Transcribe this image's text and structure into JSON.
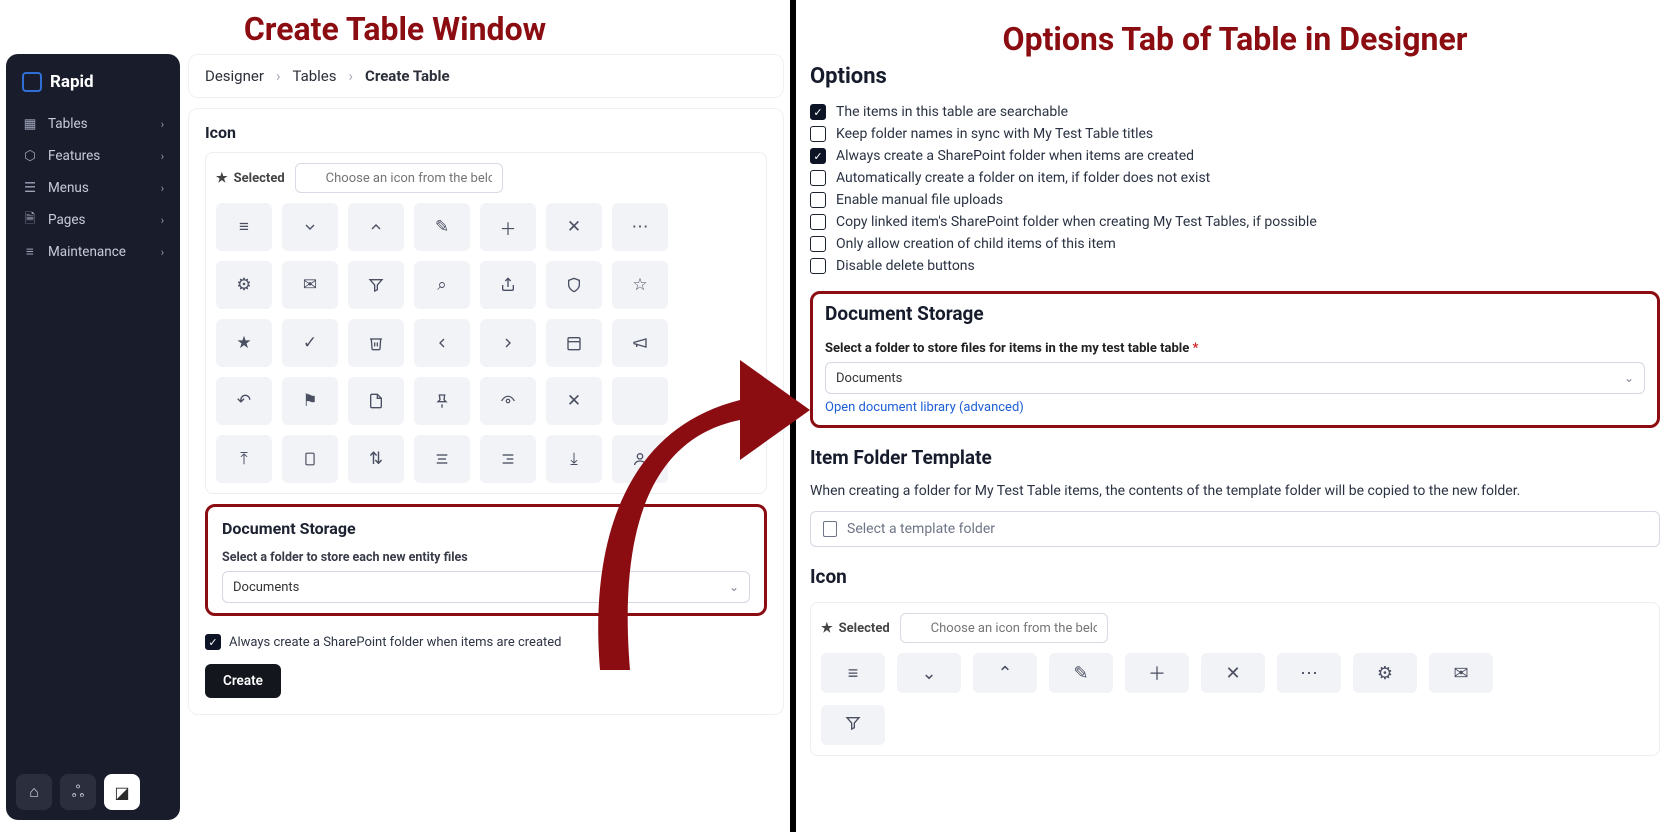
{
  "left_title": "Create Table Window",
  "right_title": "Options Tab of Table in Designer",
  "brand": "Rapid",
  "nav": {
    "items": [
      "Tables",
      "Features",
      "Menus",
      "Pages",
      "Maintenance"
    ]
  },
  "breadcrumb": {
    "a": "Designer",
    "b": "Tables",
    "c": "Create Table"
  },
  "icon_card": {
    "title": "Icon",
    "selected_label": "Selected",
    "search_placeholder": "Choose an icon from the below list..."
  },
  "doc_store_left": {
    "title": "Document Storage",
    "label": "Select a folder to store each new entity files",
    "value": "Documents",
    "check": "Always create a SharePoint folder when items are created"
  },
  "create_btn": "Create",
  "options": {
    "title": "Options",
    "rows": [
      {
        "checked": true,
        "label": "The items in this table are searchable"
      },
      {
        "checked": false,
        "label": "Keep folder names in sync with My Test Table titles"
      },
      {
        "checked": true,
        "label": "Always create a SharePoint folder when items are created"
      },
      {
        "checked": false,
        "label": "Automatically create a folder on item, if folder does not exist"
      },
      {
        "checked": false,
        "label": "Enable manual file uploads"
      },
      {
        "checked": false,
        "label": "Copy linked item's SharePoint folder when creating My Test Tables, if possible"
      },
      {
        "checked": false,
        "label": "Only allow creation of child items of this item"
      },
      {
        "checked": false,
        "label": "Disable delete buttons"
      }
    ]
  },
  "doc_store_right": {
    "title": "Document Storage",
    "label": "Select a folder to store files for items in the my test table table",
    "value": "Documents",
    "link": "Open document library (advanced)"
  },
  "item_folder": {
    "title": "Item Folder Template",
    "desc": "When creating a folder for My Test Table items, the contents of the template folder will be copied to the new folder.",
    "placeholder": "Select a template folder"
  },
  "icon_right": {
    "title": "Icon",
    "selected_label": "Selected",
    "search_placeholder": "Choose an icon from the below list..."
  }
}
